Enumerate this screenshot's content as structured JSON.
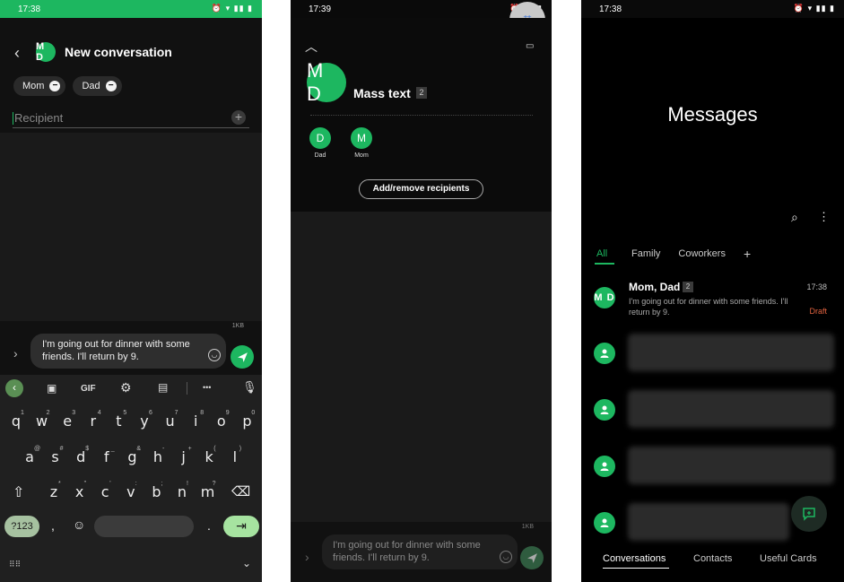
{
  "p1": {
    "status_time": "17:38",
    "header": {
      "avatar": "M D",
      "title": "New conversation"
    },
    "chips": [
      "Mom",
      "Dad"
    ],
    "recipient_placeholder": "Recipient",
    "message_size": "1KB",
    "message_text": "I'm going out for dinner with some friends. I'll return by 9.",
    "toolbar": {
      "gif": "GIF",
      "more": "•••"
    },
    "row1": [
      "q",
      "w",
      "e",
      "r",
      "t",
      "y",
      "u",
      "i",
      "o",
      "p"
    ],
    "row1_sup": [
      "1",
      "2",
      "3",
      "4",
      "5",
      "6",
      "7",
      "8",
      "9",
      "0"
    ],
    "row2": [
      "a",
      "s",
      "d",
      "f",
      "g",
      "h",
      "j",
      "k",
      "l"
    ],
    "row2_sup": [
      "@",
      "#",
      "$",
      "_",
      "&",
      "-",
      "+",
      "(",
      ")"
    ],
    "row3": [
      "z",
      "x",
      "c",
      "v",
      "b",
      "n",
      "m"
    ],
    "row3_sup": [
      "*",
      "\"",
      "'",
      ":",
      ";",
      "!",
      "?"
    ],
    "sym_key": "?123",
    "comma": ",",
    "period": "."
  },
  "p2": {
    "status_time": "17:39",
    "avatar": "M D",
    "title": "Mass text",
    "count": "2",
    "members": [
      {
        "initial": "D",
        "name": "Dad"
      },
      {
        "initial": "M",
        "name": "Mom"
      }
    ],
    "add_remove": "Add/remove recipients",
    "message_size": "1KB",
    "message_text": "I'm going out for dinner with some friends. I'll return by 9."
  },
  "p3": {
    "status_time": "17:38",
    "title": "Messages",
    "tabs": [
      "All",
      "Family",
      "Coworkers"
    ],
    "conversation": {
      "avatar": "M D",
      "name": "Mom, Dad",
      "count": "2",
      "time": "17:38",
      "preview": "I'm going out for dinner with some friends. I'll return by 9.",
      "draft": "Draft"
    },
    "bottom_nav": [
      "Conversations",
      "Contacts",
      "Useful Cards"
    ]
  },
  "colors": {
    "accent": "#1db760",
    "draft": "#e0623f",
    "background": "#000000"
  }
}
